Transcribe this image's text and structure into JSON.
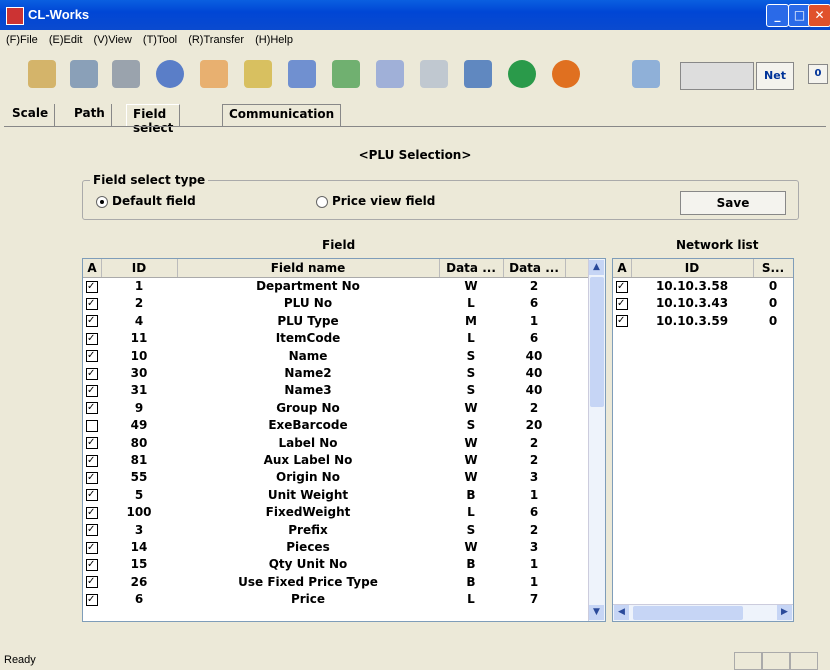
{
  "window": {
    "title": "CL-Works"
  },
  "menu": [
    "(F)File",
    "(E)Edit",
    "(V)View",
    "(T)Tool",
    "(R)Transfer",
    "(H)Help"
  ],
  "toolbar": {
    "net_label": "Net",
    "zero_label": "0"
  },
  "tabs": [
    "Scale",
    "Path",
    "Field select",
    "Communication"
  ],
  "active_tab": "Field select",
  "heading": "<PLU Selection>",
  "field_select": {
    "group_label": "Field select type",
    "option_default": "Default field",
    "option_price": "Price view field",
    "selected": "Default field",
    "save_label": "Save"
  },
  "field_table": {
    "title": "Field",
    "columns": [
      "A",
      "ID",
      "Field name",
      "Data ...",
      "Data ..."
    ],
    "rows": [
      {
        "checked": true,
        "id": "1",
        "name": "Department No",
        "type": "W",
        "len": "2"
      },
      {
        "checked": true,
        "id": "2",
        "name": "PLU No",
        "type": "L",
        "len": "6"
      },
      {
        "checked": true,
        "id": "4",
        "name": "PLU Type",
        "type": "M",
        "len": "1"
      },
      {
        "checked": true,
        "id": "11",
        "name": "ItemCode",
        "type": "L",
        "len": "6"
      },
      {
        "checked": true,
        "id": "10",
        "name": "Name",
        "type": "S",
        "len": "40"
      },
      {
        "checked": true,
        "id": "30",
        "name": "Name2",
        "type": "S",
        "len": "40"
      },
      {
        "checked": true,
        "id": "31",
        "name": "Name3",
        "type": "S",
        "len": "40"
      },
      {
        "checked": true,
        "id": "9",
        "name": "Group No",
        "type": "W",
        "len": "2"
      },
      {
        "checked": false,
        "id": "49",
        "name": "ExeBarcode",
        "type": "S",
        "len": "20"
      },
      {
        "checked": true,
        "id": "80",
        "name": "Label No",
        "type": "W",
        "len": "2"
      },
      {
        "checked": true,
        "id": "81",
        "name": "Aux Label No",
        "type": "W",
        "len": "2"
      },
      {
        "checked": true,
        "id": "55",
        "name": "Origin No",
        "type": "W",
        "len": "3"
      },
      {
        "checked": true,
        "id": "5",
        "name": "Unit Weight",
        "type": "B",
        "len": "1"
      },
      {
        "checked": true,
        "id": "100",
        "name": "FixedWeight",
        "type": "L",
        "len": "6"
      },
      {
        "checked": true,
        "id": "3",
        "name": "Prefix",
        "type": "S",
        "len": "2"
      },
      {
        "checked": true,
        "id": "14",
        "name": "Pieces",
        "type": "W",
        "len": "3"
      },
      {
        "checked": true,
        "id": "15",
        "name": "Qty Unit No",
        "type": "B",
        "len": "1"
      },
      {
        "checked": true,
        "id": "26",
        "name": "Use Fixed Price Type",
        "type": "B",
        "len": "1"
      },
      {
        "checked": true,
        "id": "6",
        "name": "Price",
        "type": "L",
        "len": "7"
      }
    ]
  },
  "network_table": {
    "title": "Network list",
    "columns": [
      "A",
      "ID",
      "S..."
    ],
    "rows": [
      {
        "checked": true,
        "id": "10.10.3.58",
        "s": "0"
      },
      {
        "checked": true,
        "id": "10.10.3.43",
        "s": "0"
      },
      {
        "checked": true,
        "id": "10.10.3.59",
        "s": "0"
      }
    ]
  },
  "status": {
    "text": "Ready"
  }
}
